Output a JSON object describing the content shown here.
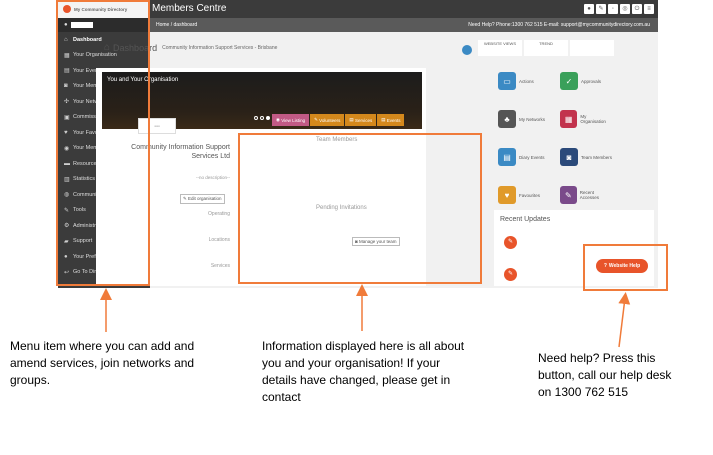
{
  "app": {
    "logo_text": "My Community Directory",
    "title": "Members Centre",
    "breadcrumb": "Home  /  dashboard",
    "help_text": "Need Help? Phone:1300 762 515 E-mail: support@mycommunitydirectory.com.au"
  },
  "sidebar": {
    "items": [
      {
        "label": "Dashboard",
        "icon": "home-icon",
        "glyph": "⌂"
      },
      {
        "label": "Your Organisation",
        "icon": "building-icon",
        "glyph": "▦"
      },
      {
        "label": "Your Events",
        "icon": "calendar-icon",
        "glyph": "▤"
      },
      {
        "label": "Your Member Groups",
        "icon": "users-icon",
        "glyph": "◙"
      },
      {
        "label": "Your Networks",
        "icon": "network-icon",
        "glyph": "✣"
      },
      {
        "label": "Commissioned Service",
        "icon": "clipboard-icon",
        "glyph": "▣"
      },
      {
        "label": "Your Favourites",
        "icon": "heart-icon",
        "glyph": "♥"
      },
      {
        "label": "Your Membership",
        "icon": "group-icon",
        "glyph": "◉"
      },
      {
        "label": "Resources",
        "icon": "folder-icon",
        "glyph": "▬"
      },
      {
        "label": "Statistics",
        "icon": "bar-chart-icon",
        "glyph": "▥"
      },
      {
        "label": "Community Asset Map",
        "icon": "map-icon",
        "glyph": "◍"
      },
      {
        "label": "Tools",
        "icon": "wrench-icon",
        "glyph": "✎"
      },
      {
        "label": "Administration",
        "icon": "cogs-icon",
        "glyph": "⚙"
      },
      {
        "label": "Support",
        "icon": "support-icon",
        "glyph": "▰"
      },
      {
        "label": "Your Preferences",
        "icon": "user-icon",
        "glyph": "●"
      },
      {
        "label": "Go To Directory",
        "icon": "back-icon",
        "glyph": "↩"
      }
    ]
  },
  "dashboard": {
    "title": "Dashboard",
    "subtitle": "Community Information Support Services - Brisbane",
    "stat_labels": [
      "WEBSITE VIEWS",
      "TREND"
    ]
  },
  "banner": {
    "title": "You and Your Organisation",
    "buttons": [
      "View Listing",
      "Volunteers",
      "Services",
      "Events"
    ]
  },
  "org": {
    "name": "Community Information Support Services Ltd",
    "no_description": "--no description--",
    "edit_button": "Edit organisation",
    "labels": [
      "Operating",
      "Locations",
      "Services"
    ],
    "team_heading": "Team Members",
    "pending_heading": "Pending Invitations",
    "manage_button": "Manage your team"
  },
  "tiles": [
    {
      "label": "Actions",
      "color": "#3b8ac4",
      "icon": "inbox-icon"
    },
    {
      "label": "Approvals",
      "color": "#3aa05a",
      "icon": "check-icon"
    },
    {
      "label": "My Networks",
      "color": "#555555",
      "icon": "sitemap-icon"
    },
    {
      "label": "My Organisation",
      "color": "#c2334d",
      "icon": "grid-icon"
    },
    {
      "label": "Diary Events",
      "color": "#3b8ac4",
      "icon": "calendar-icon"
    },
    {
      "label": "Team Members",
      "color": "#2b4a7a",
      "icon": "team-icon"
    },
    {
      "label": "Favourites",
      "color": "#e09a2a",
      "icon": "heart-icon"
    },
    {
      "label": "Recent Accesses",
      "color": "#7a4a8a",
      "icon": "pencil-icon"
    }
  ],
  "updates": {
    "title": "Recent Updates"
  },
  "website_help": "Website Help",
  "callouts": {
    "menu": "Menu item where you can add and amend services, join networks and groups.",
    "info": "Information displayed here is all about you and your organisation! If your details have changed, please get in contact",
    "help": "Need help? Press this button, call our help desk on 1300 762 515"
  },
  "colors": {
    "accent": "#e8542a",
    "callout_border": "#f07b3a",
    "sidebar_bg": "#3b3b3b"
  }
}
